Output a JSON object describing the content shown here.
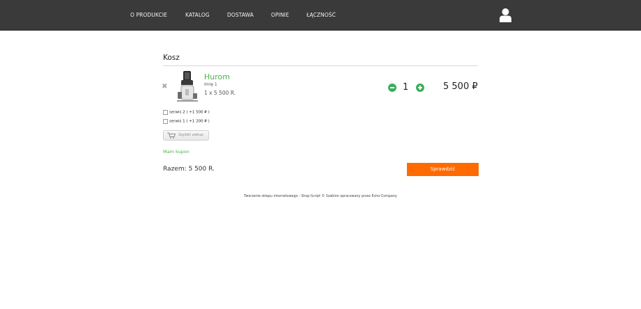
{
  "header": {
    "nav": [
      "O PRODUKCIE",
      "KATALOG",
      "DOSTAWA",
      "OPINIE",
      "ŁĄCZNOŚĆ"
    ],
    "user_icon": "user-icon",
    "bg_color": "#3a3a3a"
  },
  "cart": {
    "title": "Kosz",
    "item": {
      "name": "Hurom",
      "variant": "Imię 1",
      "line": "1 x 5 500 R.",
      "quantity": "1",
      "total": "5 500 ₽"
    },
    "services": [
      {
        "label": "serwis 2 ( +1 500 ₽ )",
        "checked": false
      },
      {
        "label": "serwis 1 ( +1 200 ₽ )",
        "checked": false
      }
    ],
    "quick_buy_label": "Szybki zakup",
    "coupon_label": "Mam kupon",
    "total_label": "Razem: 5 500 R.",
    "checkout_label": "Sprawdzić"
  },
  "footer": {
    "text": "Tworzenie sklepu internetowego - Shop-Script © Szablon opracowany przez Echo-Company"
  },
  "colors": {
    "accent_green": "#4caf50",
    "checkout_orange": "#ff6a00"
  }
}
